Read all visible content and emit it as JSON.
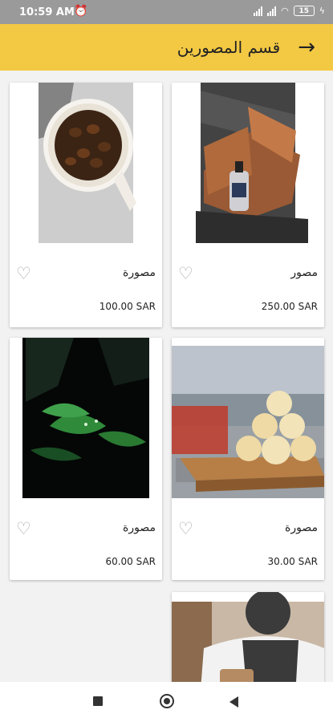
{
  "status_bar": {
    "time": "10:59 AM",
    "battery": "15"
  },
  "header": {
    "title": "قسم المصورين",
    "back_icon": "→"
  },
  "products": [
    {
      "name": "مصور",
      "price": "250.00 SAR"
    },
    {
      "name": "مصورة",
      "price": "100.00 SAR"
    },
    {
      "name": "مصورة",
      "price": "30.00 SAR"
    },
    {
      "name": "مصورة",
      "price": "60.00 SAR"
    },
    {
      "name": "",
      "price": ""
    }
  ],
  "icons": {
    "heart": "♡"
  }
}
